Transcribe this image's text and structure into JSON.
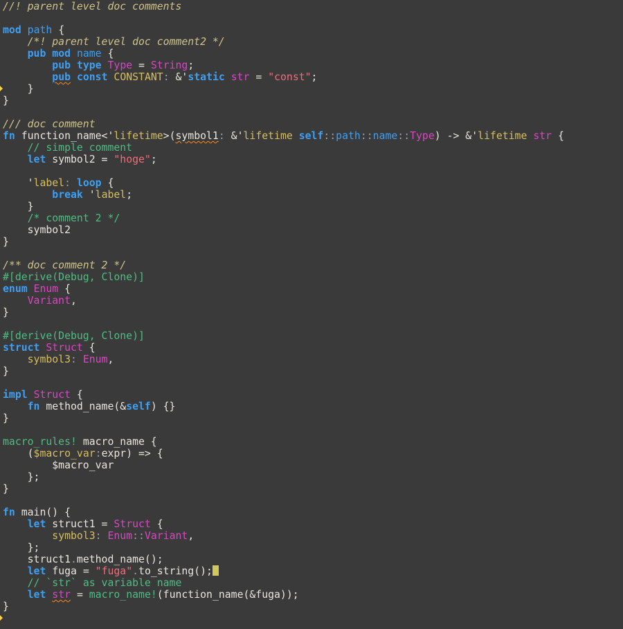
{
  "colors": {
    "background": "#3a3a3a",
    "text": "#e8e6df",
    "doc_comment": "#cfc38a",
    "comment": "#4ebd83",
    "keyword": "#3e9ff3",
    "type": "#d847c3",
    "constant": "#d8bf5e",
    "string": "#f26d7a",
    "lifetime": "#d8bf5e",
    "attribute": "#4ebd83",
    "macro": "#4ebd83",
    "cursor": "#d2c85f",
    "gutter_marker": "#ffd24a",
    "warning_squiggle": "#ff8a1a"
  },
  "editor": {
    "cursor_line": 48,
    "gutter_markers": [
      {
        "line": 7,
        "icon": "warning-arrow-icon"
      },
      {
        "line": 52,
        "icon": "warning-arrow-icon"
      }
    ],
    "lines": [
      [
        {
          "c": "doc",
          "t": "//! parent level doc comments"
        }
      ],
      [],
      [
        {
          "c": "kw",
          "t": "mod"
        },
        {
          "c": "plain",
          "t": " "
        },
        {
          "c": "mod",
          "t": "path"
        },
        {
          "c": "plain",
          "t": " {"
        }
      ],
      [
        {
          "c": "plain",
          "t": "    "
        },
        {
          "c": "doc",
          "t": "/*! parent level doc comment2 */"
        }
      ],
      [
        {
          "c": "plain",
          "t": "    "
        },
        {
          "c": "kw",
          "t": "pub"
        },
        {
          "c": "plain",
          "t": " "
        },
        {
          "c": "kw",
          "t": "mod"
        },
        {
          "c": "plain",
          "t": " "
        },
        {
          "c": "mod",
          "t": "name"
        },
        {
          "c": "plain",
          "t": " {"
        }
      ],
      [
        {
          "c": "plain",
          "t": "        "
        },
        {
          "c": "kw",
          "t": "pub"
        },
        {
          "c": "plain",
          "t": " "
        },
        {
          "c": "kw",
          "t": "type"
        },
        {
          "c": "plain",
          "t": " "
        },
        {
          "c": "type",
          "t": "Type"
        },
        {
          "c": "plain",
          "t": " = "
        },
        {
          "c": "type",
          "t": "String"
        },
        {
          "c": "plain",
          "t": ";"
        }
      ],
      [
        {
          "c": "plain",
          "t": "        "
        },
        {
          "c": "kw",
          "t": "pub",
          "squig": true
        },
        {
          "c": "plain",
          "t": " "
        },
        {
          "c": "kw",
          "t": "const"
        },
        {
          "c": "plain",
          "t": " "
        },
        {
          "c": "const",
          "t": "CONSTANT"
        },
        {
          "c": "punct",
          "t": ":"
        },
        {
          "c": "plain",
          "t": " &'"
        },
        {
          "c": "kw",
          "t": "static"
        },
        {
          "c": "plain",
          "t": " "
        },
        {
          "c": "type",
          "t": "str"
        },
        {
          "c": "plain",
          "t": " = "
        },
        {
          "c": "str",
          "t": "\"const\""
        },
        {
          "c": "plain",
          "t": ";"
        }
      ],
      [
        {
          "c": "plain",
          "t": "    }"
        }
      ],
      [
        {
          "c": "plain",
          "t": "}"
        }
      ],
      [],
      [
        {
          "c": "doc",
          "t": "/// doc comment"
        }
      ],
      [
        {
          "c": "kw",
          "t": "fn"
        },
        {
          "c": "plain",
          "t": " function_name<'"
        },
        {
          "c": "life",
          "t": "lifetime"
        },
        {
          "c": "plain",
          "t": ">("
        },
        {
          "c": "plain",
          "t": "symbol1",
          "squig": true
        },
        {
          "c": "punct",
          "t": ":"
        },
        {
          "c": "plain",
          "t": " &'"
        },
        {
          "c": "life",
          "t": "lifetime"
        },
        {
          "c": "plain",
          "t": " "
        },
        {
          "c": "kw",
          "t": "self"
        },
        {
          "c": "punct",
          "t": "::"
        },
        {
          "c": "mod",
          "t": "path"
        },
        {
          "c": "punct",
          "t": "::"
        },
        {
          "c": "mod",
          "t": "name"
        },
        {
          "c": "punct",
          "t": "::"
        },
        {
          "c": "type",
          "t": "Type"
        },
        {
          "c": "plain",
          "t": ") -> &'"
        },
        {
          "c": "life",
          "t": "lifetime"
        },
        {
          "c": "plain",
          "t": " "
        },
        {
          "c": "type",
          "t": "str"
        },
        {
          "c": "plain",
          "t": " {"
        }
      ],
      [
        {
          "c": "plain",
          "t": "    "
        },
        {
          "c": "comment",
          "t": "// simple comment"
        }
      ],
      [
        {
          "c": "plain",
          "t": "    "
        },
        {
          "c": "kw",
          "t": "let"
        },
        {
          "c": "plain",
          "t": " symbol2 = "
        },
        {
          "c": "str",
          "t": "\"hoge\""
        },
        {
          "c": "plain",
          "t": ";"
        }
      ],
      [],
      [
        {
          "c": "plain",
          "t": "    '"
        },
        {
          "c": "life",
          "t": "label"
        },
        {
          "c": "punct",
          "t": ":"
        },
        {
          "c": "plain",
          "t": " "
        },
        {
          "c": "kw",
          "t": "loop"
        },
        {
          "c": "plain",
          "t": " {"
        }
      ],
      [
        {
          "c": "plain",
          "t": "        "
        },
        {
          "c": "kw",
          "t": "break"
        },
        {
          "c": "plain",
          "t": " '"
        },
        {
          "c": "life",
          "t": "label"
        },
        {
          "c": "plain",
          "t": ";"
        }
      ],
      [
        {
          "c": "plain",
          "t": "    }"
        }
      ],
      [
        {
          "c": "plain",
          "t": "    "
        },
        {
          "c": "comment",
          "t": "/* comment 2 */"
        }
      ],
      [
        {
          "c": "plain",
          "t": "    symbol2"
        }
      ],
      [
        {
          "c": "plain",
          "t": "}"
        }
      ],
      [],
      [
        {
          "c": "doc",
          "t": "/** doc comment 2 */"
        }
      ],
      [
        {
          "c": "attr",
          "t": "#[derive(Debug, Clone)]"
        }
      ],
      [
        {
          "c": "kw",
          "t": "enum"
        },
        {
          "c": "plain",
          "t": " "
        },
        {
          "c": "type",
          "t": "Enum"
        },
        {
          "c": "plain",
          "t": " {"
        }
      ],
      [
        {
          "c": "plain",
          "t": "    "
        },
        {
          "c": "type",
          "t": "Variant"
        },
        {
          "c": "plain",
          "t": ","
        }
      ],
      [
        {
          "c": "plain",
          "t": "}"
        }
      ],
      [],
      [
        {
          "c": "attr",
          "t": "#[derive(Debug, Clone)]"
        }
      ],
      [
        {
          "c": "kw",
          "t": "struct"
        },
        {
          "c": "plain",
          "t": " "
        },
        {
          "c": "type",
          "t": "Struct"
        },
        {
          "c": "plain",
          "t": " {"
        }
      ],
      [
        {
          "c": "plain",
          "t": "    "
        },
        {
          "c": "var",
          "t": "symbol3"
        },
        {
          "c": "punct",
          "t": ":"
        },
        {
          "c": "plain",
          "t": " "
        },
        {
          "c": "type",
          "t": "Enum"
        },
        {
          "c": "plain",
          "t": ","
        }
      ],
      [
        {
          "c": "plain",
          "t": "}"
        }
      ],
      [],
      [
        {
          "c": "kw",
          "t": "impl"
        },
        {
          "c": "plain",
          "t": " "
        },
        {
          "c": "type",
          "t": "Struct"
        },
        {
          "c": "plain",
          "t": " {"
        }
      ],
      [
        {
          "c": "plain",
          "t": "    "
        },
        {
          "c": "kw",
          "t": "fn"
        },
        {
          "c": "plain",
          "t": " method_name(&"
        },
        {
          "c": "kw",
          "t": "self"
        },
        {
          "c": "plain",
          "t": ") {}"
        }
      ],
      [
        {
          "c": "plain",
          "t": "}"
        }
      ],
      [],
      [
        {
          "c": "macro",
          "t": "macro_rules!"
        },
        {
          "c": "plain",
          "t": " macro_name {"
        }
      ],
      [
        {
          "c": "plain",
          "t": "    ("
        },
        {
          "c": "var",
          "t": "$macro_var"
        },
        {
          "c": "punct",
          "t": ":"
        },
        {
          "c": "plain",
          "t": "expr) => {"
        }
      ],
      [
        {
          "c": "plain",
          "t": "        $macro_var"
        }
      ],
      [
        {
          "c": "plain",
          "t": "    };"
        }
      ],
      [
        {
          "c": "plain",
          "t": "}"
        }
      ],
      [],
      [
        {
          "c": "kw",
          "t": "fn"
        },
        {
          "c": "plain",
          "t": " main() {"
        }
      ],
      [
        {
          "c": "plain",
          "t": "    "
        },
        {
          "c": "kw",
          "t": "let"
        },
        {
          "c": "plain",
          "t": " struct1 = "
        },
        {
          "c": "type",
          "t": "Struct"
        },
        {
          "c": "plain",
          "t": " {"
        }
      ],
      [
        {
          "c": "plain",
          "t": "        "
        },
        {
          "c": "var",
          "t": "symbol3"
        },
        {
          "c": "punct",
          "t": ":"
        },
        {
          "c": "plain",
          "t": " "
        },
        {
          "c": "type",
          "t": "Enum"
        },
        {
          "c": "punct",
          "t": "::"
        },
        {
          "c": "type",
          "t": "Variant"
        },
        {
          "c": "plain",
          "t": ","
        }
      ],
      [
        {
          "c": "plain",
          "t": "    };"
        }
      ],
      [
        {
          "c": "plain",
          "t": "    struct1"
        },
        {
          "c": "punct",
          "t": "."
        },
        {
          "c": "plain",
          "t": "method_name();"
        }
      ],
      [
        {
          "c": "plain",
          "t": "    "
        },
        {
          "c": "kw",
          "t": "let"
        },
        {
          "c": "plain",
          "t": " fuga = "
        },
        {
          "c": "str",
          "t": "\"fuga\""
        },
        {
          "c": "punct",
          "t": "."
        },
        {
          "c": "plain",
          "t": "to_string();"
        }
      ],
      [
        {
          "c": "plain",
          "t": "    "
        },
        {
          "c": "comment",
          "t": "// `str` as variable name"
        }
      ],
      [
        {
          "c": "plain",
          "t": "    "
        },
        {
          "c": "kw",
          "t": "let"
        },
        {
          "c": "plain",
          "t": " "
        },
        {
          "c": "type",
          "t": "str",
          "squig": true
        },
        {
          "c": "plain",
          "t": " = "
        },
        {
          "c": "macro",
          "t": "macro_name!"
        },
        {
          "c": "plain",
          "t": "(function_name(&fuga));"
        }
      ],
      [
        {
          "c": "plain",
          "t": "}"
        }
      ]
    ]
  }
}
